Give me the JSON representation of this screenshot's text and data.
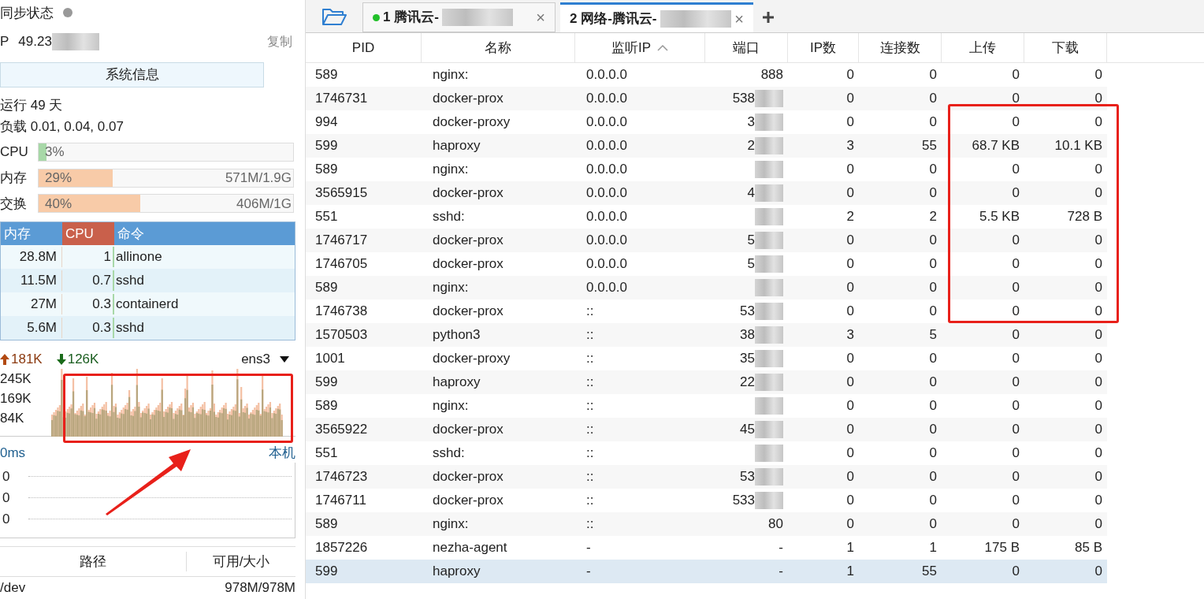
{
  "sidebar": {
    "sync": {
      "label": "同步状态",
      "online": false
    },
    "ip": {
      "label": "P",
      "value": "49.23",
      "blurred": true,
      "copy": "复制"
    },
    "sysinfo_button": "系统信息",
    "uptime": "运行 49 天",
    "load": "负载 0.01, 0.04, 0.07",
    "meters": [
      {
        "label": "CPU",
        "percent": "3%",
        "level": 0.03,
        "kind": "cpu"
      },
      {
        "label": "内存",
        "percent": "29%",
        "level": 0.29,
        "detail": "571M/1.9G",
        "kind": "mem"
      },
      {
        "label": "交换",
        "percent": "40%",
        "level": 0.4,
        "detail": "406M/1G",
        "kind": "mem"
      }
    ],
    "processes": {
      "columns": [
        {
          "label": "内存",
          "sorted": false
        },
        {
          "label": "CPU",
          "sorted": true
        },
        {
          "label": "命令",
          "sorted": false
        }
      ],
      "rows": [
        [
          "28.8M",
          "1",
          "allinone"
        ],
        [
          "11.5M",
          "0.7",
          "sshd"
        ],
        [
          "27M",
          "0.3",
          "containerd"
        ],
        [
          "5.6M",
          "0.3",
          "sshd"
        ]
      ]
    },
    "network": {
      "up": "181K",
      "down": "126K",
      "interface": "ens3",
      "y_labels": [
        "245K",
        "169K",
        "84K"
      ]
    },
    "latency": {
      "label": "0ms",
      "target": "本机",
      "y_labels": [
        "0",
        "0",
        "0"
      ]
    },
    "disks": {
      "columns": [
        "路径",
        "可用/大小"
      ],
      "rows": [
        [
          "/dev",
          "978M/978M"
        ]
      ]
    }
  },
  "tabs": [
    {
      "label": "1 腾讯云-",
      "selected": false,
      "connected": true,
      "blurred": true,
      "close": "×"
    },
    {
      "label": "2 网络-腾讯云-",
      "selected": true,
      "connected": false,
      "blurred": true,
      "close": "×"
    }
  ],
  "table": {
    "columns": [
      {
        "label": "PID",
        "sorted": false
      },
      {
        "label": "名称",
        "sorted": false
      },
      {
        "label": "监听IP",
        "sorted": true
      },
      {
        "label": "端口",
        "sorted": false
      },
      {
        "label": "IP数",
        "sorted": false
      },
      {
        "label": "连接数",
        "sorted": false
      },
      {
        "label": "上传",
        "sorted": false
      },
      {
        "label": "下载",
        "sorted": false
      }
    ],
    "rows": [
      {
        "pid": "589",
        "name": "nginx:",
        "ip": "0.0.0.0",
        "port": "888",
        "blurred": false,
        "ips": "0",
        "conns": "0",
        "up": "0",
        "down": "0",
        "selected": false
      },
      {
        "pid": "1746731",
        "name": "docker-prox",
        "ip": "0.0.0.0",
        "port": "538",
        "blurred": true,
        "ips": "0",
        "conns": "0",
        "up": "0",
        "down": "0",
        "selected": false
      },
      {
        "pid": "994",
        "name": "docker-proxy",
        "ip": "0.0.0.0",
        "port": "3",
        "blurred": true,
        "ips": "0",
        "conns": "0",
        "up": "0",
        "down": "0",
        "selected": false
      },
      {
        "pid": "599",
        "name": "haproxy",
        "ip": "0.0.0.0",
        "port": "2",
        "blurred": true,
        "ips": "3",
        "conns": "55",
        "up": "68.7 KB",
        "down": "10.1 KB",
        "selected": false
      },
      {
        "pid": "589",
        "name": "nginx:",
        "ip": "0.0.0.0",
        "blurred": true,
        "ips": "0",
        "conns": "0",
        "up": "0",
        "down": "0",
        "selected": false
      },
      {
        "pid": "3565915",
        "name": "docker-prox",
        "ip": "0.0.0.0",
        "port": "4",
        "blurred": true,
        "ips": "0",
        "conns": "0",
        "up": "0",
        "down": "0",
        "selected": false
      },
      {
        "pid": "551",
        "name": "sshd:",
        "ip": "0.0.0.0",
        "blurred": true,
        "ips": "2",
        "conns": "2",
        "up": "5.5 KB",
        "down": "728 B",
        "selected": false
      },
      {
        "pid": "1746717",
        "name": "docker-prox",
        "ip": "0.0.0.0",
        "port": "5",
        "blurred": true,
        "ips": "0",
        "conns": "0",
        "up": "0",
        "down": "0",
        "selected": false
      },
      {
        "pid": "1746705",
        "name": "docker-prox",
        "ip": "0.0.0.0",
        "port": "5",
        "blurred": true,
        "ips": "0",
        "conns": "0",
        "up": "0",
        "down": "0",
        "selected": false
      },
      {
        "pid": "589",
        "name": "nginx:",
        "ip": "0.0.0.0",
        "blurred": true,
        "ips": "0",
        "conns": "0",
        "up": "0",
        "down": "0",
        "selected": false
      },
      {
        "pid": "1746738",
        "name": "docker-prox",
        "ip": "::",
        "port": "53",
        "blurred": true,
        "ips": "0",
        "conns": "0",
        "up": "0",
        "down": "0",
        "selected": false
      },
      {
        "pid": "1570503",
        "name": "python3",
        "ip": "::",
        "port": "38",
        "blurred": true,
        "ips": "3",
        "conns": "5",
        "up": "0",
        "down": "0",
        "selected": false
      },
      {
        "pid": "1001",
        "name": "docker-proxy",
        "ip": "::",
        "port": "35",
        "blurred": true,
        "ips": "0",
        "conns": "0",
        "up": "0",
        "down": "0",
        "selected": false
      },
      {
        "pid": "599",
        "name": "haproxy",
        "ip": "::",
        "port": "22",
        "blurred": true,
        "ips": "0",
        "conns": "0",
        "up": "0",
        "down": "0",
        "selected": false
      },
      {
        "pid": "589",
        "name": "nginx:",
        "ip": "::",
        "blurred": true,
        "ips": "0",
        "conns": "0",
        "up": "0",
        "down": "0",
        "selected": false
      },
      {
        "pid": "3565922",
        "name": "docker-prox",
        "ip": "::",
        "port": "45",
        "blurred": true,
        "ips": "0",
        "conns": "0",
        "up": "0",
        "down": "0",
        "selected": false
      },
      {
        "pid": "551",
        "name": "sshd:",
        "ip": "::",
        "blurred": true,
        "ips": "0",
        "conns": "0",
        "up": "0",
        "down": "0",
        "selected": false
      },
      {
        "pid": "1746723",
        "name": "docker-prox",
        "ip": "::",
        "port": "53",
        "blurred": true,
        "ips": "0",
        "conns": "0",
        "up": "0",
        "down": "0",
        "selected": false
      },
      {
        "pid": "1746711",
        "name": "docker-prox",
        "ip": "::",
        "port": "533",
        "blurred": true,
        "ips": "0",
        "conns": "0",
        "up": "0",
        "down": "0",
        "selected": false
      },
      {
        "pid": "589",
        "name": "nginx:",
        "ip": "::",
        "port": "80",
        "blurred": false,
        "ips": "0",
        "conns": "0",
        "up": "0",
        "down": "0",
        "selected": false
      },
      {
        "pid": "1857226",
        "name": "nezha-agent",
        "ip": "-",
        "port": "-",
        "blurred": false,
        "ips": "1",
        "conns": "1",
        "up": "175 B",
        "down": "85 B",
        "selected": false
      },
      {
        "pid": "599",
        "name": "haproxy",
        "ip": "-",
        "port": "-",
        "blurred": false,
        "ips": "1",
        "conns": "55",
        "up": "0",
        "down": "0",
        "selected": true
      }
    ]
  }
}
